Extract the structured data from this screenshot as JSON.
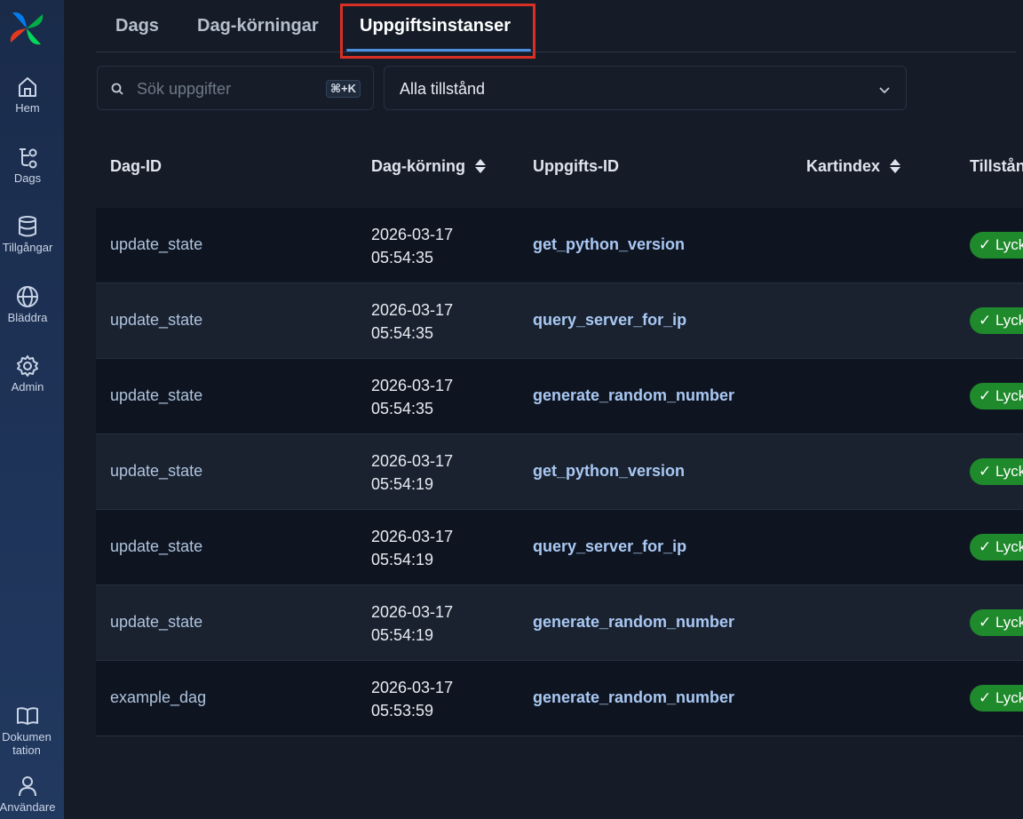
{
  "sidebar": {
    "items": [
      {
        "label": "Hem",
        "icon": "home-icon"
      },
      {
        "label": "Dags",
        "icon": "dags-icon"
      },
      {
        "label": "Tillgångar",
        "icon": "database-icon"
      },
      {
        "label": "Bläddra",
        "icon": "globe-icon"
      },
      {
        "label": "Admin",
        "icon": "gear-icon"
      }
    ],
    "bottom_items": [
      {
        "label": "Dokumentation",
        "icon": "book-icon"
      },
      {
        "label": "Användare",
        "icon": "user-icon"
      }
    ]
  },
  "tabs": [
    {
      "label": "Dags"
    },
    {
      "label": "Dag-körningar"
    },
    {
      "label": "Uppgiftsinstanser",
      "active": true
    }
  ],
  "filters": {
    "search_placeholder": "Sök uppgifter",
    "search_shortcut": "⌘+K",
    "state_select": "Alla tillstånd"
  },
  "table": {
    "headers": {
      "dag_id": "Dag-ID",
      "dag_run": "Dag-körning",
      "task_id": "Uppgifts-ID",
      "map_index": "Kartindex",
      "state": "Tillstånd"
    },
    "rows": [
      {
        "dag_id": "update_state",
        "date": "2026-03-17",
        "time": "05:54:35",
        "task_id": "get_python_version",
        "state": "Lyckades"
      },
      {
        "dag_id": "update_state",
        "date": "2026-03-17",
        "time": "05:54:35",
        "task_id": "query_server_for_ip",
        "state": "Lyckades"
      },
      {
        "dag_id": "update_state",
        "date": "2026-03-17",
        "time": "05:54:35",
        "task_id": "generate_random_number",
        "state": "Lyckades"
      },
      {
        "dag_id": "update_state",
        "date": "2026-03-17",
        "time": "05:54:19",
        "task_id": "get_python_version",
        "state": "Lyckades"
      },
      {
        "dag_id": "update_state",
        "date": "2026-03-17",
        "time": "05:54:19",
        "task_id": "query_server_for_ip",
        "state": "Lyckades"
      },
      {
        "dag_id": "update_state",
        "date": "2026-03-17",
        "time": "05:54:19",
        "task_id": "generate_random_number",
        "state": "Lyckades"
      },
      {
        "dag_id": "example_dag",
        "date": "2026-03-17",
        "time": "05:53:59",
        "task_id": "generate_random_number",
        "state": "Lyckades"
      }
    ]
  },
  "colors": {
    "success": "#1f8a2c",
    "accent": "#4a90e2",
    "highlight": "#d93025"
  }
}
